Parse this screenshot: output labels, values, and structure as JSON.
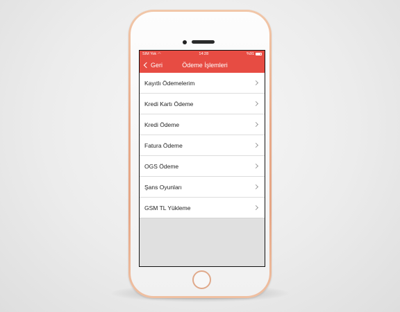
{
  "status_bar": {
    "carrier": "SIM Yok",
    "time": "14:28",
    "battery": "%91",
    "battery_level": 0.91
  },
  "nav": {
    "back_label": "Geri",
    "title": "Ödeme İşlemleri"
  },
  "menu": {
    "items": [
      {
        "label": "Kayıtlı Ödemelerim"
      },
      {
        "label": "Kredi Kartı Ödeme"
      },
      {
        "label": "Kredi Ödeme"
      },
      {
        "label": "Fatura Ödeme"
      },
      {
        "label": "OGS Ödeme"
      },
      {
        "label": "Şans Oyunları"
      },
      {
        "label": "GSM TL Yükleme"
      }
    ]
  },
  "colors": {
    "accent": "#e74c43",
    "device_frame": "#e8a988",
    "empty_area": "#e0e0e0"
  },
  "icons": {
    "back": "chevron-left-icon",
    "row": "chevron-right-icon",
    "wifi": "wifi-icon",
    "battery": "battery-icon"
  }
}
